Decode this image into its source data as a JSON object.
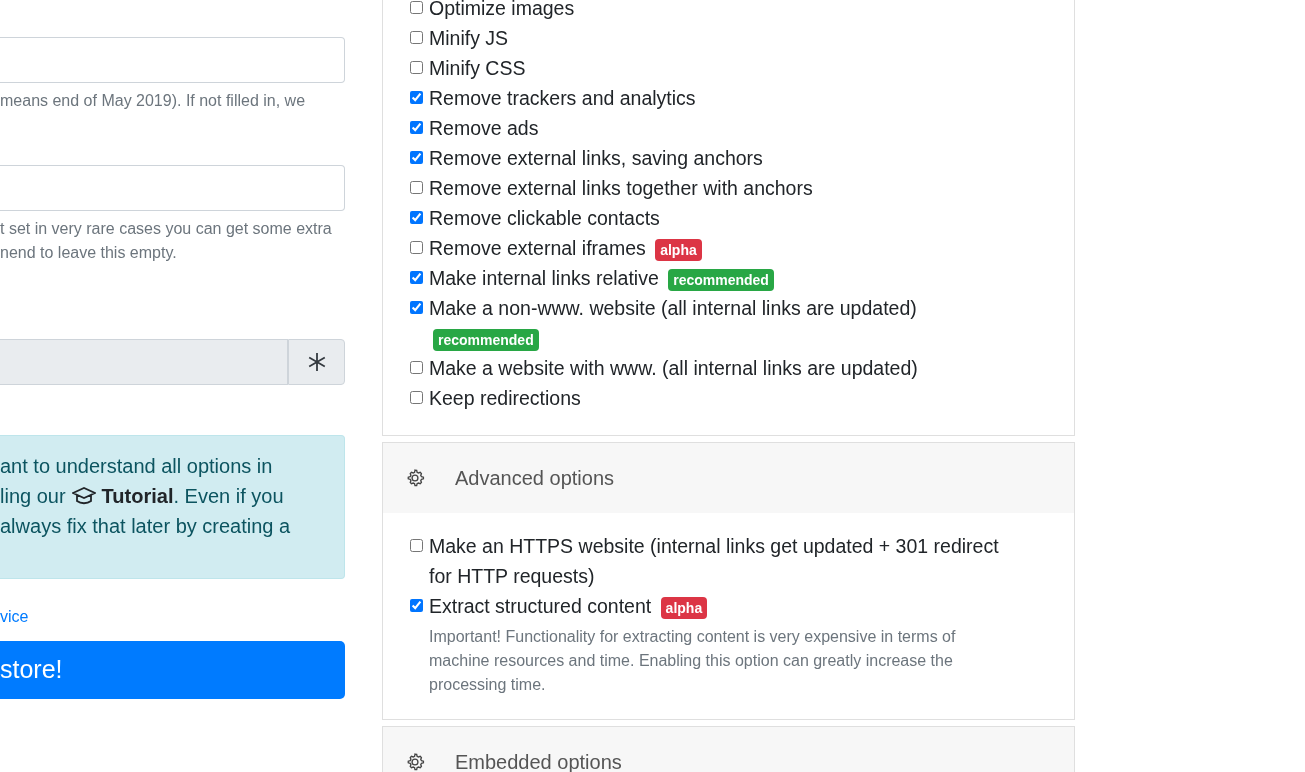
{
  "left": {
    "fields": [
      {
        "disabled": false,
        "help_lines": [
          "means end of May 2019). If not filled in, we"
        ]
      },
      {
        "disabled": false,
        "help_lines": [
          "t set in very rare cases you can get some extra",
          "nend to leave this empty."
        ]
      },
      {
        "disabled": true
      }
    ],
    "info_box": {
      "lines": [
        {
          "before": "ant to understand all options in"
        },
        {
          "before": "ling our",
          "after": "**Tutorial**. Even if you"
        },
        {
          "before": "always fix that later by creating a"
        }
      ]
    },
    "link": "vice",
    "submit_button": "store!"
  },
  "option_cards": [
    {
      "options": [
        {
          "label": "Optimize images",
          "checked": false
        },
        {
          "label": "Minify JS",
          "checked": false
        },
        {
          "label": "Minify CSS",
          "checked": false
        },
        {
          "label": "Remove trackers and analytics",
          "checked": true
        },
        {
          "label": "Remove ads",
          "checked": true
        },
        {
          "label": "Remove external links, saving anchors",
          "checked": true
        },
        {
          "label": "Remove external links together with anchors",
          "checked": false
        },
        {
          "label": "Remove clickable contacts",
          "checked": true
        },
        {
          "label": "Remove external iframes",
          "checked": false,
          "badges": [
            {
              "text": "alpha",
              "kind": "danger"
            }
          ]
        },
        {
          "label": "Make internal links relative",
          "checked": true,
          "badges": [
            {
              "text": "recommended",
              "kind": "success"
            }
          ]
        },
        {
          "label": "Make a non-www. website (all internal links are updated)",
          "checked": true,
          "badges": [
            {
              "text": "recommended",
              "kind": "success"
            }
          ]
        },
        {
          "label": "Make a website with www. (all internal links are updated)",
          "checked": false
        },
        {
          "label": "Keep redirections",
          "checked": false
        }
      ]
    },
    {
      "title": "Advanced options",
      "options": [
        {
          "label": "Make an HTTPS website (internal links get updated + 301 redirect for HTTP requests)",
          "checked": false
        },
        {
          "label": "Extract structured content",
          "checked": true,
          "badges": [
            {
              "text": "alpha",
              "kind": "danger"
            }
          ],
          "help": "Important! Functionality for extracting content is very expensive in terms of machine resources and time. Enabling this option can greatly increase the processing time."
        }
      ]
    },
    {
      "title": "Embedded options"
    }
  ]
}
